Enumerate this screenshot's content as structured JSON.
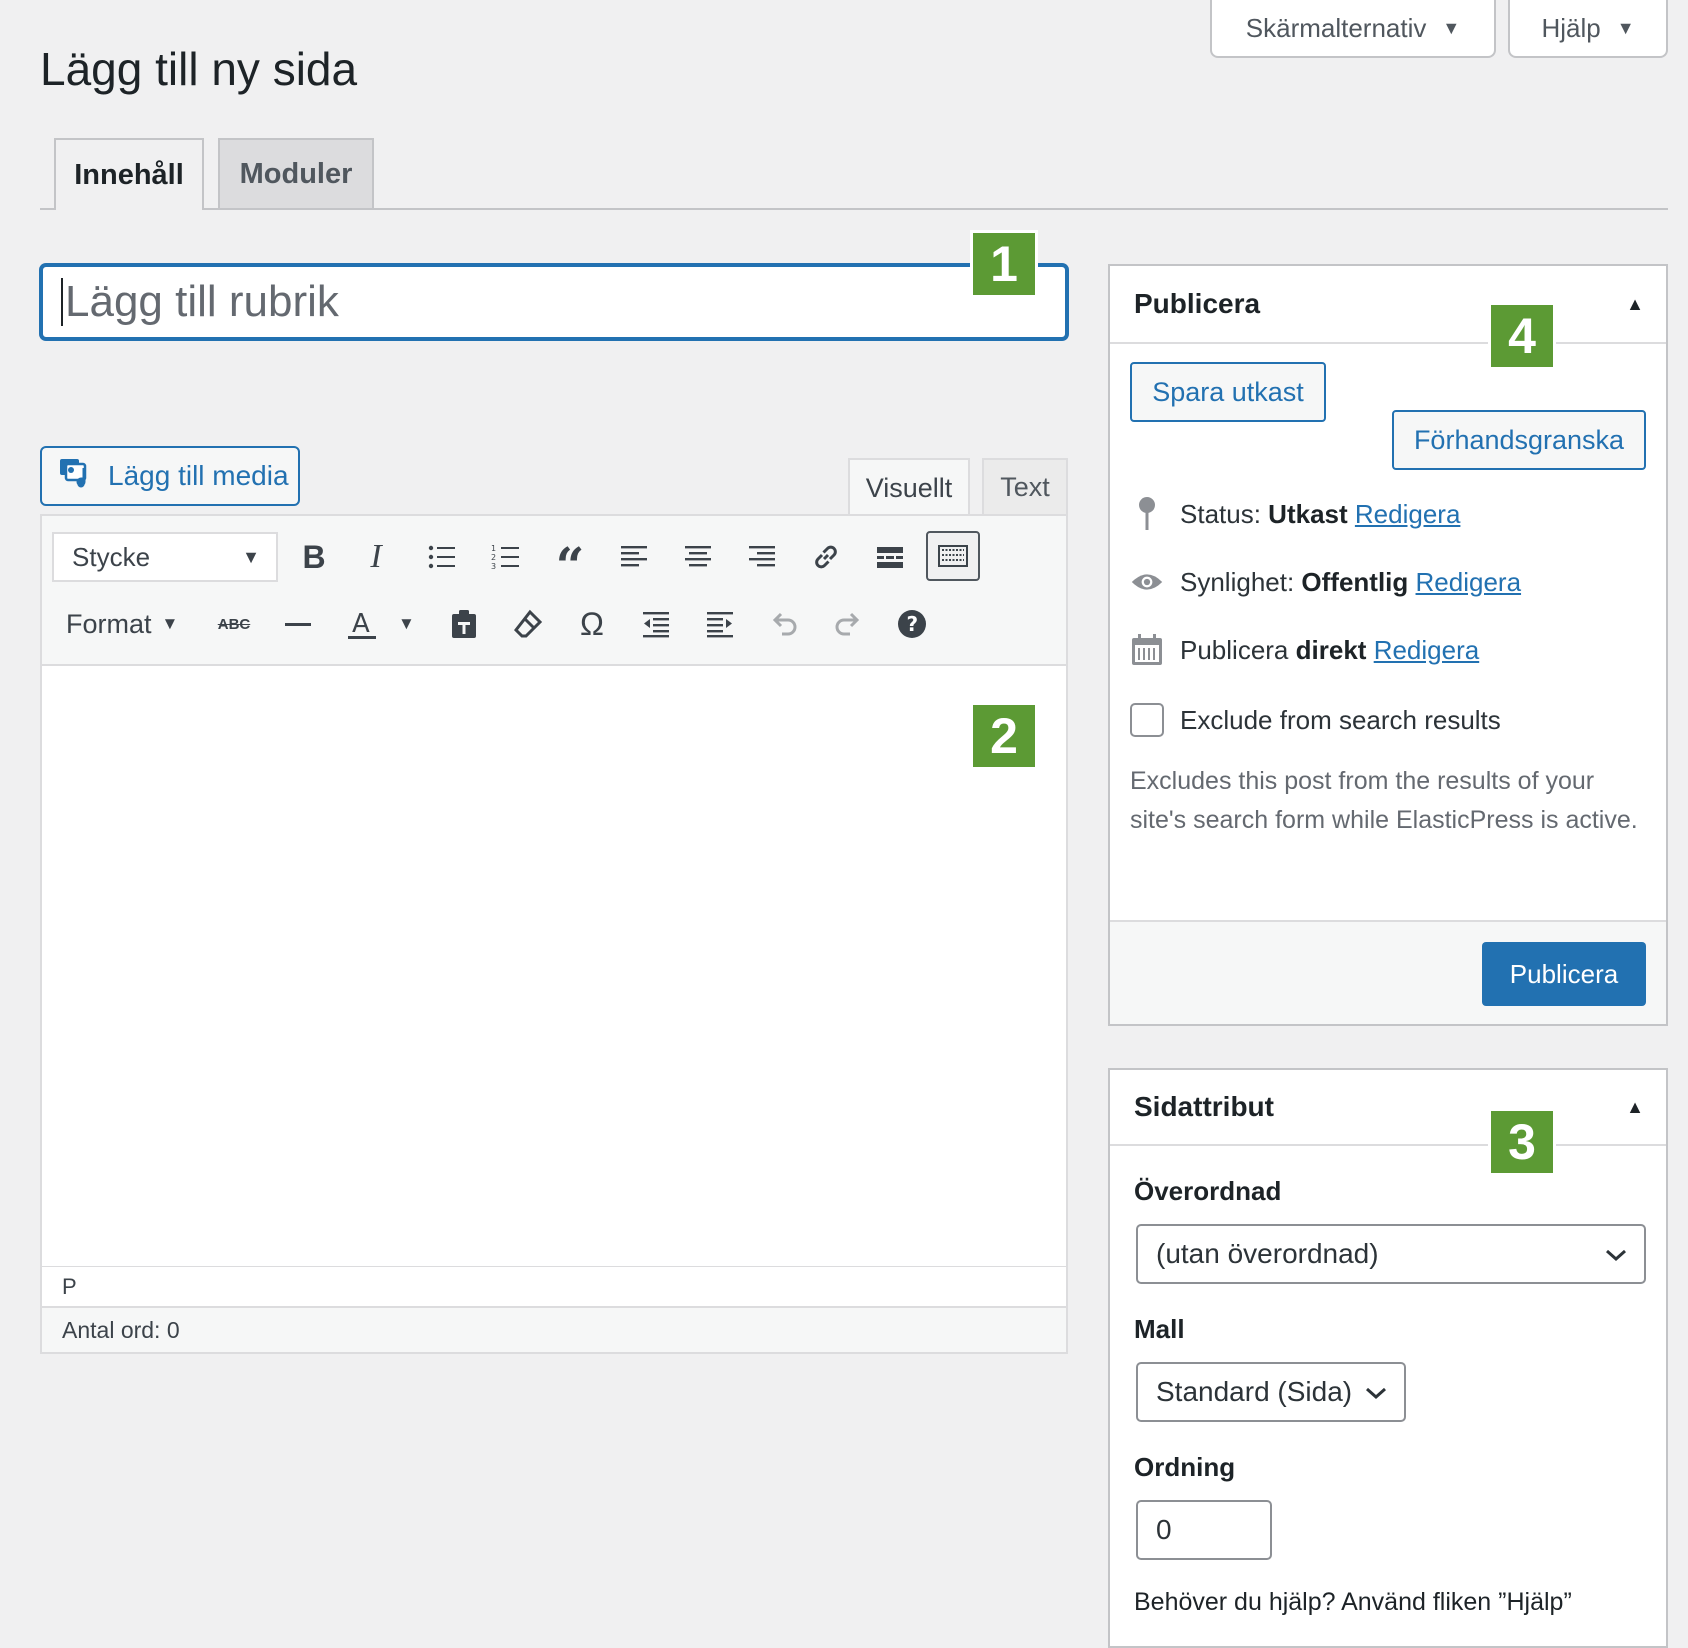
{
  "header": {
    "screen_options_label": "Skärmalternativ",
    "help_label": "Hjälp",
    "page_title": "Lägg till ny sida",
    "tabs": [
      {
        "label": "Innehåll",
        "active": true
      },
      {
        "label": "Moduler",
        "active": false
      }
    ]
  },
  "editor": {
    "title_placeholder": "Lägg till rubrik",
    "add_media_label": "Lägg till media",
    "mode_tabs": {
      "visual": "Visuellt",
      "text": "Text"
    },
    "paragraph_select": "Stycke",
    "format_menu": "Format",
    "status_path": "P",
    "word_count": "Antal ord: 0"
  },
  "badges": {
    "title": "1",
    "content": "2",
    "attributes": "3",
    "publish": "4"
  },
  "publish_box": {
    "title": "Publicera",
    "save_draft": "Spara utkast",
    "preview": "Förhandsgranska",
    "status_label": "Status:",
    "status_value": "Utkast",
    "visibility_label": "Synlighet:",
    "visibility_value": "Offentlig",
    "schedule_label": "Publicera",
    "schedule_value": "direkt",
    "edit_link": "Redigera",
    "exclude_label": "Exclude from search results",
    "exclude_desc": "Excludes this post from the results of your site's search form while ElasticPress is active.",
    "publish_button": "Publicera"
  },
  "attributes_box": {
    "title": "Sidattribut",
    "parent_label": "Överordnad",
    "parent_value": "(utan överordnad)",
    "template_label": "Mall",
    "template_value": "Standard (Sida)",
    "order_label": "Ordning",
    "order_value": "0",
    "help_text": "Behöver du hjälp? Använd fliken ”Hjälp”"
  },
  "colors": {
    "accent": "#2271b1",
    "badge": "#5c9a34",
    "background": "#f0f0f1"
  }
}
